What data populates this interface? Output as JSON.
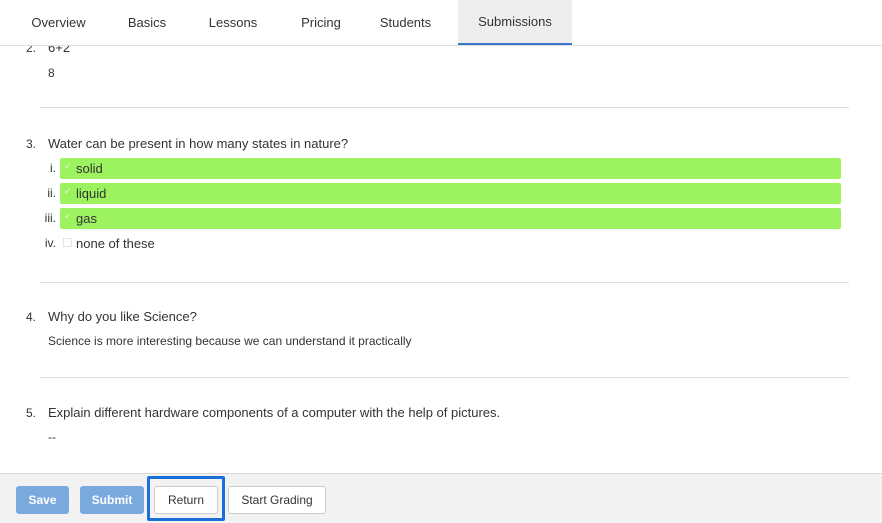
{
  "tabs": [
    {
      "label": "Overview"
    },
    {
      "label": "Basics"
    },
    {
      "label": "Lessons"
    },
    {
      "label": "Pricing"
    },
    {
      "label": "Students"
    },
    {
      "label": "Submissions",
      "active": true
    }
  ],
  "questions": [
    {
      "number": "2.",
      "text": "6+2",
      "answer": "8"
    },
    {
      "number": "3.",
      "text": "Water can be present in how many states in nature?",
      "options": [
        {
          "num": "i.",
          "label": "solid",
          "checked": true
        },
        {
          "num": "ii.",
          "label": "liquid",
          "checked": true
        },
        {
          "num": "iii.",
          "label": "gas",
          "checked": true
        },
        {
          "num": "iv.",
          "label": "none of these",
          "checked": false
        }
      ]
    },
    {
      "number": "4.",
      "text": "Why do you like Science?",
      "answer": "Science is more interesting because we can understand it practically"
    },
    {
      "number": "5.",
      "text": "Explain different hardware components of a computer with the help of pictures.",
      "answer": "--"
    }
  ],
  "footer": {
    "save_label": "Save",
    "submit_label": "Submit",
    "return_label": "Return",
    "start_grading_label": "Start Grading"
  },
  "colors": {
    "correct_option": "#9cf25f",
    "primary_button": "#79a9dd",
    "focus_ring": "#1a6fd8",
    "active_tab_indicator": "#3a77c9"
  },
  "icons": {
    "check": "check-icon",
    "checkbox": "checkbox-icon"
  }
}
